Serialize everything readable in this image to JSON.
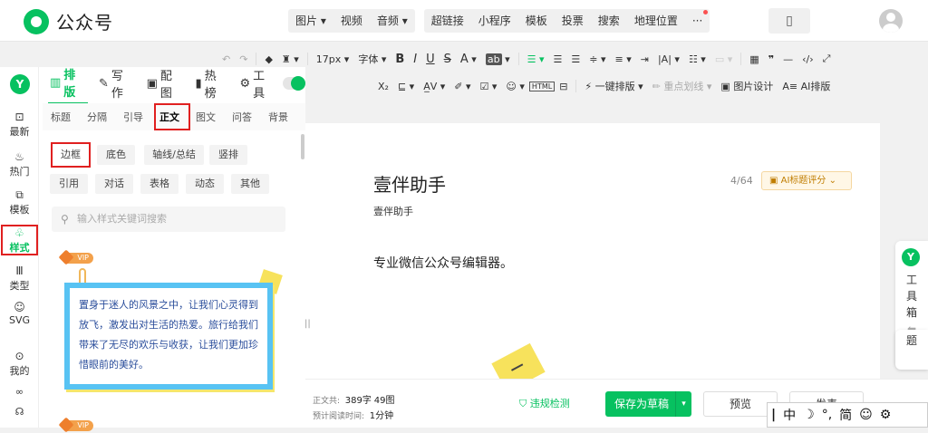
{
  "app": {
    "logo_text": "公众号"
  },
  "insert_bar": {
    "group1": [
      "图片",
      "视频",
      "音频"
    ],
    "group2": [
      "超链接",
      "小程序",
      "模板",
      "投票",
      "搜索",
      "地理位置",
      "···"
    ]
  },
  "toolbar1": {
    "font_size": "17px",
    "font": "字体",
    "items": [
      "B",
      "I",
      "U",
      "S",
      "A",
      "ab"
    ]
  },
  "toolbar2": {
    "one_click": "一键排版",
    "highlight": "重点划线",
    "image_design": "图片设计",
    "ai_layout": "AI排版"
  },
  "sidebar": {
    "items": [
      {
        "icon": "message-icon",
        "glyph": "⊡",
        "label": "最新"
      },
      {
        "icon": "fire-icon",
        "glyph": "♨",
        "label": "热门"
      },
      {
        "icon": "template-icon",
        "glyph": "⧉",
        "label": "模板"
      },
      {
        "icon": "style-icon",
        "glyph": "♧",
        "label": "样式"
      },
      {
        "icon": "type-icon",
        "glyph": "Ⅲ",
        "label": "类型"
      },
      {
        "icon": "svg-icon",
        "glyph": "☺",
        "label": "SVG"
      },
      {
        "icon": "user-icon",
        "glyph": "⊙",
        "label": "我的"
      }
    ],
    "active": "样式"
  },
  "panel_tabs": [
    {
      "icon": "layout-icon",
      "glyph": "▥",
      "label": "排版",
      "active": true
    },
    {
      "icon": "write-icon",
      "glyph": "✎",
      "label": "写作"
    },
    {
      "icon": "image-icon",
      "glyph": "▣",
      "label": "配图"
    },
    {
      "icon": "bookmark-icon",
      "glyph": "▮",
      "label": "热榜"
    },
    {
      "icon": "tools-icon",
      "glyph": "⚙",
      "label": "工具"
    }
  ],
  "style_tabs": [
    "标题",
    "分隔",
    "引导",
    "正文",
    "图文",
    "问答",
    "背景"
  ],
  "style_tab_active": "正文",
  "chips": [
    "边框",
    "底色",
    "轴线/总结",
    "竖排",
    "引用",
    "对话",
    "表格",
    "动态",
    "其他"
  ],
  "search": {
    "placeholder": "输入样式关键词搜索"
  },
  "sample": {
    "vip": "VIP",
    "text": "置身于迷人的风景之中，让我们心灵得到放飞，激发出对生活的热爱。旅行给我们带来了无尽的欢乐与收获，让我们更加珍惜眼前的美好。"
  },
  "editor": {
    "title": "壹伴助手",
    "title_count": "4/64",
    "ai_title": "AI标题评分",
    "author": "壹伴助手",
    "body": "专业微信公众号编辑器。"
  },
  "bottom": {
    "stat_label1": "正文共:",
    "words": "389字",
    "images": "49图",
    "stat_label2": "预计阅读时间:",
    "read_time": "1分钟",
    "check": "违规检测",
    "save": "保存为草稿",
    "preview": "预览",
    "publish": "发表"
  },
  "toolbox": {
    "label": "工具箱",
    "extra": "题"
  },
  "ime": [
    "中",
    "☽",
    "°,",
    "简",
    "☺",
    "⚙"
  ]
}
